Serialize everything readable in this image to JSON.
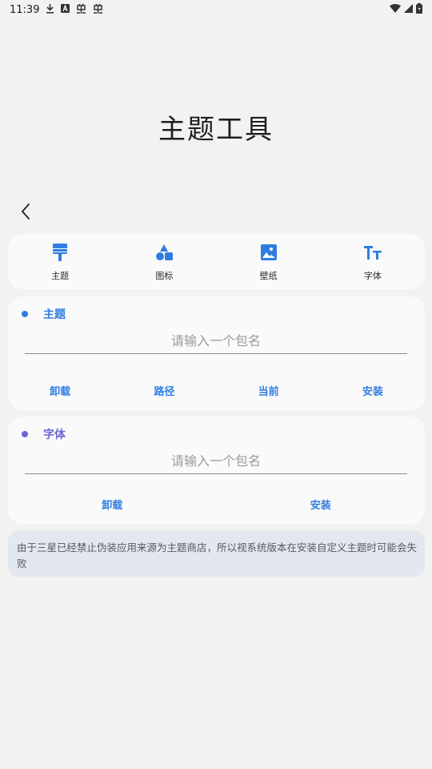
{
  "status_bar": {
    "time": "11:39",
    "icons": [
      "download-icon",
      "a-icon",
      "bug-icon",
      "bug-icon",
      "wifi-icon",
      "signal-icon",
      "battery-icon"
    ]
  },
  "page": {
    "title": "主题工具"
  },
  "tools": [
    {
      "label": "主题",
      "icon": "paint-roller-icon"
    },
    {
      "label": "图标",
      "icon": "shapes-icon"
    },
    {
      "label": "壁纸",
      "icon": "image-icon"
    },
    {
      "label": "字体",
      "icon": "text-tt-icon"
    }
  ],
  "theme_section": {
    "title": "主题",
    "placeholder": "请输入一个包名",
    "value": "",
    "buttons": [
      "卸载",
      "路径",
      "当前",
      "安装"
    ],
    "accent": "#2f7de1"
  },
  "font_section": {
    "title": "字体",
    "placeholder": "请输入一个包名",
    "value": "",
    "buttons": [
      "卸载",
      "安装"
    ],
    "accent": "#6b67d6"
  },
  "notice": {
    "text": "由于三星已经禁止伪装应用来源为主题商店，所以视系统版本在安装自定义主题时可能会失败"
  },
  "colors": {
    "blue": "#2f7de1",
    "purple": "#6b67d6",
    "background": "#f2f2f2",
    "card": "#fafafa",
    "notice_bg": "#e2e8ee"
  }
}
